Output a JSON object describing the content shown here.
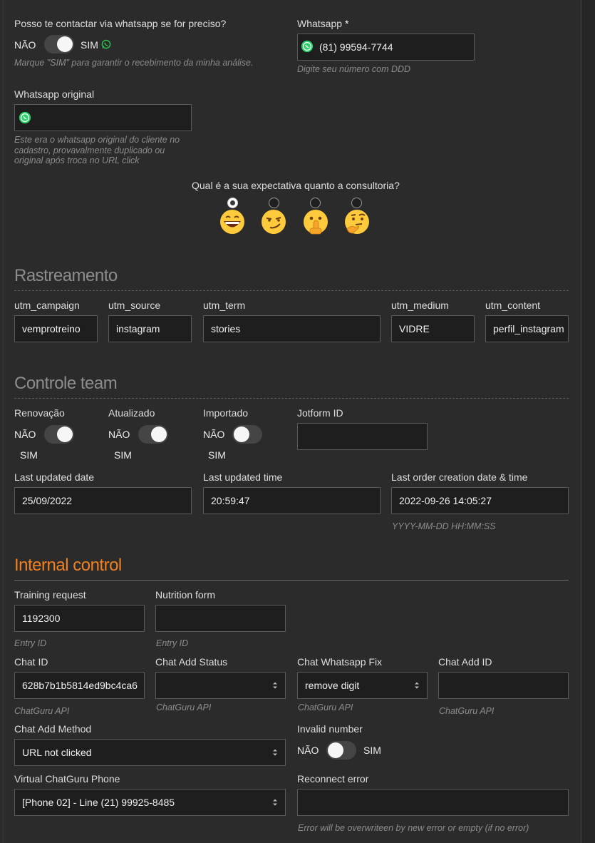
{
  "contact": {
    "question": "Posso te contactar via whatsapp se for preciso?",
    "no": "NÃO",
    "yes": "SIM",
    "hint": "Marque \"SIM\" para garantir o recebimento da minha análise.",
    "whatsapp_label": "Whatsapp",
    "whatsapp_required": "*",
    "whatsapp_value": "(81) 99594-7744",
    "whatsapp_hint": "Digite seu número com DDD",
    "original_label": "Whatsapp original",
    "original_value": "",
    "original_hint": "Este era o whatsapp original do cliente no cadastro, provavalmente duplicado ou original após troca no URL click"
  },
  "expectation": {
    "question": "Qual é a sua expectativa quanto a consultoria?",
    "options": [
      "grinning-face",
      "smirking-face",
      "shushing-face",
      "thinking-face"
    ],
    "selected_index": 0
  },
  "tracking": {
    "title": "Rastreamento",
    "fields": [
      {
        "label": "utm_campaign",
        "value": "vemprotreino"
      },
      {
        "label": "utm_source",
        "value": "instagram"
      },
      {
        "label": "utm_term",
        "value": "stories"
      },
      {
        "label": "utm_medium",
        "value": "VIDRE"
      },
      {
        "label": "utm_content",
        "value": "perfil_instagram"
      }
    ]
  },
  "team": {
    "title": "Controle team",
    "renovacao": {
      "label": "Renovação",
      "no": "NÃO",
      "yes": "SIM",
      "on": true
    },
    "atualizado": {
      "label": "Atualizado",
      "no": "NÃO",
      "yes": "SIM",
      "on": true
    },
    "importado": {
      "label": "Importado",
      "no": "NÃO",
      "yes": "SIM",
      "on": false
    },
    "jotform": {
      "label": "Jotform ID",
      "value": ""
    },
    "last_date": {
      "label": "Last updated date",
      "value": "25/09/2022"
    },
    "last_time": {
      "label": "Last updated time",
      "value": "20:59:47"
    },
    "last_order": {
      "label": "Last order creation date & time",
      "value": "2022-09-26 14:05:27",
      "hint": "YYYY-MM-DD HH:MM:SS"
    }
  },
  "internal": {
    "title": "Internal control",
    "training": {
      "label": "Training request",
      "value": "1192300",
      "hint": "Entry ID"
    },
    "nutrition": {
      "label": "Nutrition form",
      "value": "",
      "hint": "Entry ID"
    },
    "chat_id": {
      "label": "Chat ID",
      "value": "628b7b1b5814ed9bc4ca6",
      "hint": "ChatGuru API"
    },
    "chat_add_status": {
      "label": "Chat Add Status",
      "value": "",
      "hint": "ChatGuru API"
    },
    "chat_wa_fix": {
      "label": "Chat Whatsapp Fix",
      "value": "remove digit",
      "hint": "ChatGuru API"
    },
    "chat_add_id": {
      "label": "Chat Add ID",
      "value": "",
      "hint": "ChatGuru API"
    },
    "chat_add_method": {
      "label": "Chat Add Method",
      "value": "URL not clicked"
    },
    "invalid_number": {
      "label": "Invalid number",
      "no": "NÃO",
      "yes": "SIM",
      "on": false
    },
    "virtual_phone": {
      "label": "Virtual ChatGuru Phone",
      "value": "[Phone 02] - Line (21) 99925-8485"
    },
    "reconnect": {
      "label": "Reconnect error",
      "value": "",
      "hint": "Error will be overwriteen by new error or empty (if no error)"
    }
  },
  "colors": {
    "background": "#2b2b2b",
    "input_bg": "#1e1e1e",
    "accent_orange": "#f08020",
    "whatsapp_green": "#25d366"
  }
}
